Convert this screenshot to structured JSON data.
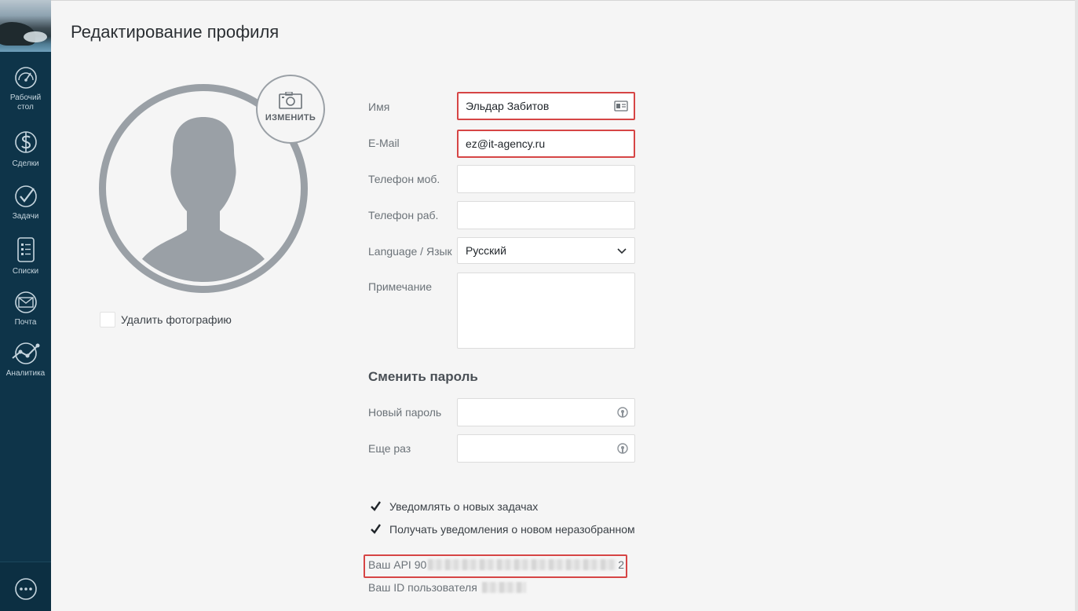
{
  "page": {
    "title": "Редактирование профиля"
  },
  "sidebar": {
    "items": [
      {
        "label_line1": "Рабочий",
        "label_line2": "стол",
        "icon": "dashboard-gauge-icon"
      },
      {
        "label_line1": "Сделки",
        "icon": "dollar-icon"
      },
      {
        "label_line1": "Задачи",
        "icon": "check-circle-icon"
      },
      {
        "label_line1": "Списки",
        "icon": "list-icon"
      },
      {
        "label_line1": "Почта",
        "icon": "mail-icon"
      },
      {
        "label_line1": "Аналитика",
        "icon": "analytics-icon"
      }
    ],
    "chat_icon": "chat-icon",
    "background": "#0e3449"
  },
  "photo": {
    "change_label": "ИЗМЕНИТЬ",
    "delete_label": "Удалить фотографию",
    "delete_checked": false
  },
  "form": {
    "name": {
      "label": "Имя",
      "value": "Эльдар Забитов"
    },
    "email": {
      "label": "E-Mail",
      "value": "ez@it-agency.ru"
    },
    "phone_mobile": {
      "label": "Телефон моб.",
      "value": ""
    },
    "phone_work": {
      "label": "Телефон раб.",
      "value": ""
    },
    "language": {
      "label": "Language / Язык",
      "value": "Русский"
    },
    "note": {
      "label": "Примечание",
      "value": ""
    }
  },
  "password": {
    "section_title": "Сменить пароль",
    "new_label": "Новый пароль",
    "repeat_label": "Еще раз"
  },
  "notifications": {
    "tasks_label": "Уведомлять о новых задачах",
    "tasks_checked": true,
    "unsorted_label": "Получать уведомления о новом неразобранном",
    "unsorted_checked": true
  },
  "api": {
    "key_label": "Ваш API",
    "key_prefix": "90",
    "key_suffix": "2",
    "user_id_label": "Ваш ID пользователя"
  },
  "colors": {
    "highlight": "#d64545",
    "sidebar": "#0e3449"
  }
}
